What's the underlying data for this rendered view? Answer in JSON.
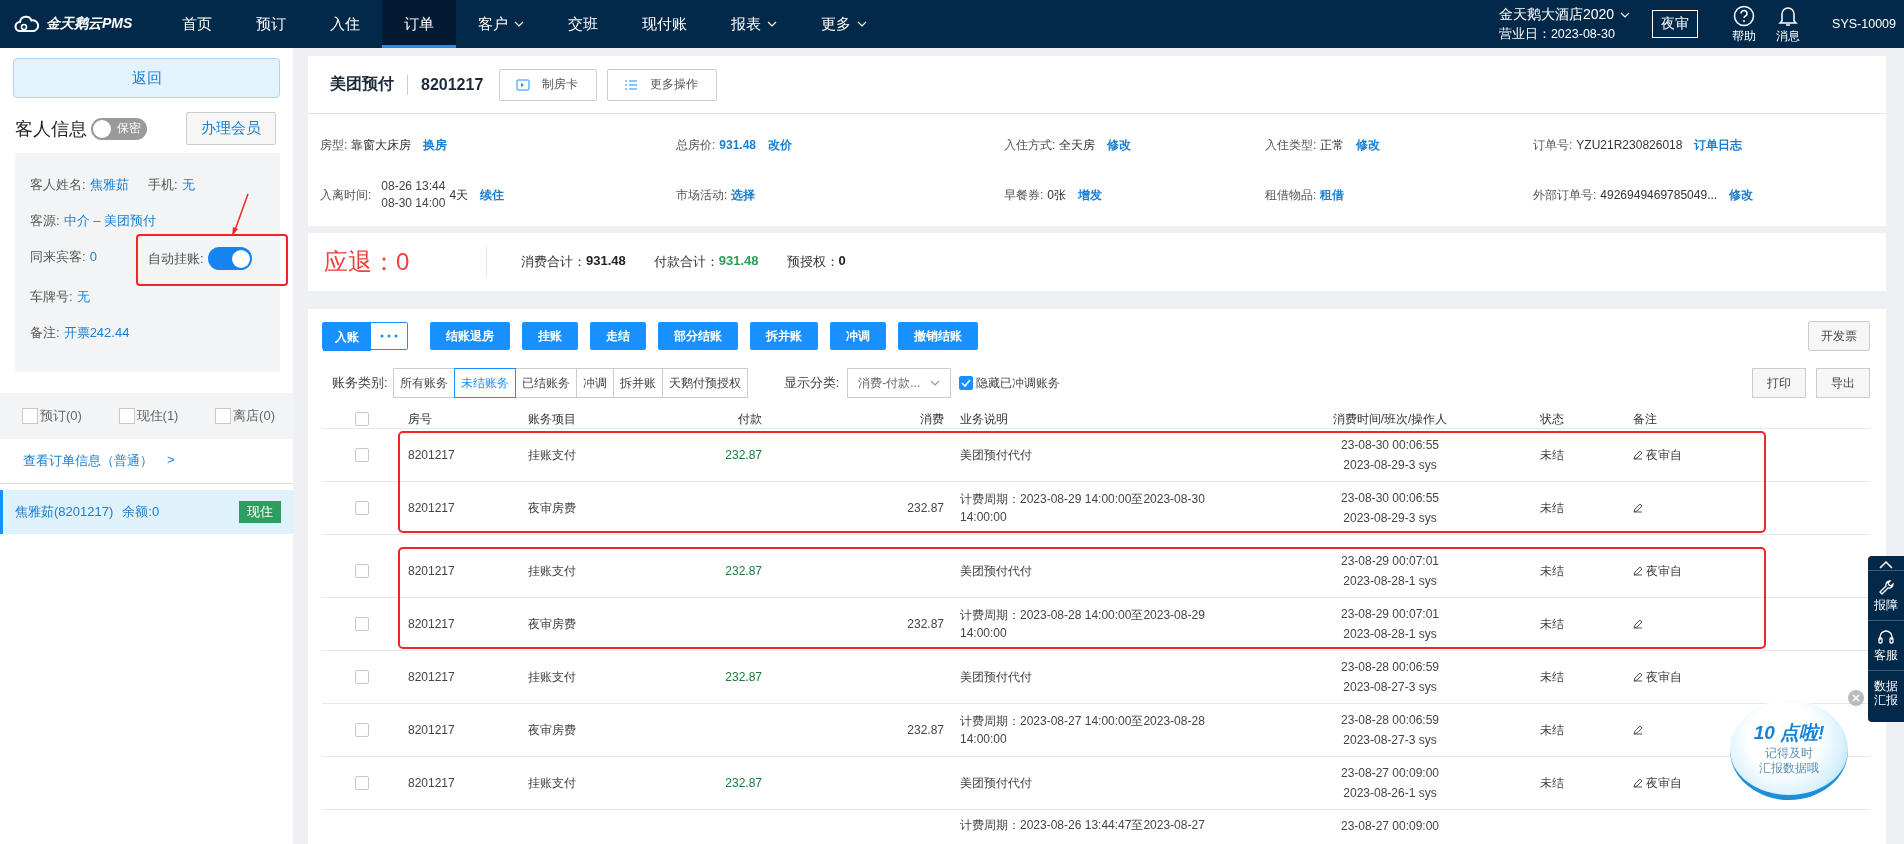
{
  "nav": {
    "logo": "金天鹅云PMS",
    "items": [
      {
        "label": "首页",
        "selected": false,
        "dropdown": false
      },
      {
        "label": "预订",
        "selected": false,
        "dropdown": false
      },
      {
        "label": "入住",
        "selected": false,
        "dropdown": false
      },
      {
        "label": "订单",
        "selected": true,
        "dropdown": false
      },
      {
        "label": "客户",
        "selected": false,
        "dropdown": true
      },
      {
        "label": "交班",
        "selected": false,
        "dropdown": false
      },
      {
        "label": "现付账",
        "selected": false,
        "dropdown": false
      },
      {
        "label": "报表",
        "selected": false,
        "dropdown": true
      },
      {
        "label": "更多",
        "selected": false,
        "dropdown": true
      }
    ],
    "hotel": "金天鹅大酒店2020",
    "business_date": "营业日：2023-08-30",
    "night_audit": "夜审",
    "help": "帮助",
    "messages": "消息",
    "user": "SYS-10009"
  },
  "guest_panel": {
    "back": "返回",
    "title": "客人信息",
    "privacy_toggle": {
      "label": "保密",
      "on": false
    },
    "member_button": "办理会员",
    "fields": [
      {
        "label": "客人姓名:",
        "value": "焦雅茹"
      },
      {
        "label": "手机:",
        "value": "无"
      },
      {
        "label": "客源:",
        "value": "中介  – 美团预付"
      },
      {
        "label": "同来宾客:",
        "value": "0"
      },
      {
        "label": "车牌号:",
        "value": "无"
      },
      {
        "label": "备注:",
        "value": "开票242.44"
      }
    ],
    "auto_charge": {
      "label": "自动挂账:",
      "on": true,
      "highlighted": true
    },
    "filters": [
      {
        "label": "预订(0)",
        "checked": false
      },
      {
        "label": "现住(1)",
        "checked": false
      },
      {
        "label": "离店(0)",
        "checked": false
      }
    ],
    "order_link": "查看订单信息（普通）",
    "order_link_arrow": ">",
    "rooms": [
      {
        "name": "焦雅茹(8201217)",
        "balance": "余额:0",
        "status": "现住",
        "selected": true
      }
    ]
  },
  "order_header": {
    "source": "美团预付",
    "order_no": "8201217",
    "actions": [
      {
        "label": "制房卡"
      },
      {
        "label": "更多操作"
      }
    ]
  },
  "order_info": [
    {
      "label": "房型:",
      "value": "靠窗大床房",
      "value_link": false,
      "link": "换房"
    },
    {
      "label": "总房价:",
      "value": "931.48",
      "value_link": true,
      "link": "改价"
    },
    {
      "label": "入住方式:",
      "value": "全天房",
      "value_link": false,
      "link": "修改"
    },
    {
      "label": "入住类型:",
      "value": "正常",
      "value_link": false,
      "link": "修改"
    },
    {
      "label": "订单号:",
      "value": "YZU21R230826018",
      "value_link": false,
      "link": "订单日志"
    },
    {
      "label": "入离时间:",
      "dates": [
        "08-26 13:44",
        "08-30 14:00"
      ],
      "value": "4天",
      "value_link": false,
      "link": "续住"
    },
    {
      "label": "市场活动:",
      "link": "选择"
    },
    {
      "label": "早餐券:",
      "value": "0张",
      "value_link": false,
      "link": "增发"
    },
    {
      "label": "租借物品:",
      "link": "租借"
    },
    {
      "label": "外部订单号:",
      "value": "4926949469785049...",
      "value_link": false,
      "link": "修改"
    }
  ],
  "summary": {
    "refund_label": "应退：",
    "refund": "0",
    "totals": [
      {
        "label": "消费合计：",
        "value": "931.48",
        "color": "#222222"
      },
      {
        "label": "付款合计：",
        "value": "931.48",
        "color": "#2a9d55"
      },
      {
        "label": "预授权：",
        "value": "0",
        "color": "#222222"
      }
    ]
  },
  "ledger": {
    "actions": [
      {
        "label": "入账",
        "kind": "split"
      },
      {
        "label": "结账退房",
        "kind": "primary"
      },
      {
        "label": "挂账",
        "kind": "primary"
      },
      {
        "label": "走结",
        "kind": "primary"
      },
      {
        "label": "部分结账",
        "kind": "primary"
      },
      {
        "label": "拆并账",
        "kind": "primary"
      },
      {
        "label": "冲调",
        "kind": "primary"
      },
      {
        "label": "撤销结账",
        "kind": "primary"
      }
    ],
    "invoice": "开发票",
    "category_label": "账务类别:",
    "categories": [
      {
        "label": "所有账务",
        "selected": false
      },
      {
        "label": "未结账务",
        "selected": true
      },
      {
        "label": "已结账务",
        "selected": false
      },
      {
        "label": "冲调",
        "selected": false
      },
      {
        "label": "拆并账",
        "selected": false
      },
      {
        "label": "天鹅付预授权",
        "selected": false
      }
    ],
    "display_label": "显示分类:",
    "display_select": "消费-付款...",
    "hide_reversed": {
      "label": "隐藏已冲调账务",
      "checked": true
    },
    "print": "打印",
    "export": "导出",
    "columns": [
      "房号",
      "账务项目",
      "付款",
      "消费",
      "业务说明",
      "消费时间/班次/操作人",
      "状态",
      "备注"
    ],
    "header_checked": false,
    "row_groups": [
      {
        "highlighted": true,
        "rows": [
          {
            "kind": "entry",
            "checked": false,
            "room": "8201217",
            "item": "挂账支付",
            "payment": "232.87",
            "charge": "",
            "description": "美团预付代付",
            "time": "23-08-30 00:06:55",
            "shift": "2023-08-29-3 sys",
            "status": "未结",
            "note": "夜审自"
          },
          {
            "kind": "entry",
            "checked": false,
            "room": "8201217",
            "item": "夜审房费",
            "payment": "",
            "charge": "232.87",
            "description": "计费周期：2023-08-29 14:00:00至2023-08-30 14:00:00",
            "time": "23-08-30 00:06:55",
            "shift": "2023-08-29-3 sys",
            "status": "未结",
            "note": ""
          }
        ]
      },
      {
        "highlighted": true,
        "rows": [
          {
            "kind": "entry",
            "checked": false,
            "room": "8201217",
            "item": "挂账支付",
            "payment": "232.87",
            "charge": "",
            "description": "美团预付代付",
            "time": "23-08-29 00:07:01",
            "shift": "2023-08-28-1 sys",
            "status": "未结",
            "note": "夜审自"
          },
          {
            "kind": "entry",
            "checked": false,
            "room": "8201217",
            "item": "夜审房费",
            "payment": "",
            "charge": "232.87",
            "description": "计费周期：2023-08-28 14:00:00至2023-08-29 14:00:00",
            "time": "23-08-29 00:07:01",
            "shift": "2023-08-28-1 sys",
            "status": "未结",
            "note": ""
          }
        ]
      },
      {
        "rows": [
          {
            "kind": "entry",
            "checked": false,
            "room": "8201217",
            "item": "挂账支付",
            "payment": "232.87",
            "charge": "",
            "description": "美团预付代付",
            "time": "23-08-28 00:06:59",
            "shift": "2023-08-27-3 sys",
            "status": "未结",
            "note": "夜审自"
          },
          {
            "kind": "entry",
            "checked": false,
            "room": "8201217",
            "item": "夜审房费",
            "payment": "",
            "charge": "232.87",
            "description": "计费周期：2023-08-27 14:00:00至2023-08-28 14:00:00",
            "time": "23-08-28 00:06:59",
            "shift": "2023-08-27-3 sys",
            "status": "未结",
            "note": ""
          },
          {
            "kind": "entry",
            "checked": false,
            "room": "8201217",
            "item": "挂账支付",
            "payment": "232.87",
            "charge": "",
            "description": "美团预付代付",
            "time": "23-08-27 00:09:00",
            "shift": "2023-08-26-1 sys",
            "status": "未结",
            "note": "夜审自"
          },
          {
            "kind": "partial",
            "description": "计费周期：2023-08-26 13:44:47至2023-08-27",
            "time": "23-08-27 00:09:00"
          }
        ]
      }
    ]
  },
  "side_tools": [
    {
      "label": "报障"
    },
    {
      "label": "客服"
    },
    {
      "label": "数据汇报"
    }
  ],
  "reminder": {
    "title": "10 点啦!",
    "lines": [
      "记得及时",
      "汇报数据哦"
    ]
  }
}
